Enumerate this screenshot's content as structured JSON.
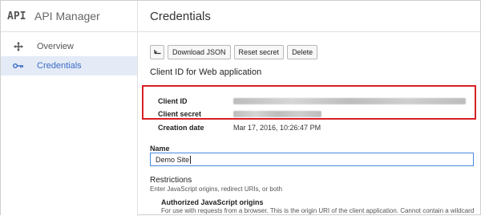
{
  "brand": {
    "logo_text": "API",
    "title": "API Manager"
  },
  "sidebar": {
    "items": [
      {
        "label": "Overview",
        "icon": "move-icon",
        "active": false
      },
      {
        "label": "Credentials",
        "icon": "key-icon",
        "active": true
      }
    ]
  },
  "header": {
    "title": "Credentials"
  },
  "toolbar": {
    "back_icon": "back-arrow-icon",
    "download_label": "Download JSON",
    "reset_label": "Reset secret",
    "delete_label": "Delete"
  },
  "client": {
    "section_title": "Client ID for Web application",
    "id_label": "Client ID",
    "secret_label": "Client secret",
    "created_label": "Creation date",
    "created_value": "Mar 17, 2016, 10:26:47 PM"
  },
  "name_field": {
    "label": "Name",
    "value": "Demo Site"
  },
  "restrictions": {
    "title": "Restrictions",
    "description": "Enter JavaScript origins, redirect URIs, or both",
    "origins_title": "Authorized JavaScript origins",
    "origins_description": "For use with requests from a browser. This is the origin URI of the client application. Cannot contain a wildcard"
  },
  "colors": {
    "highlight_border": "#d62026",
    "active_nav_bg": "#e4ebf7",
    "active_nav_text": "#3b6cc4",
    "input_border": "#4a8ae0"
  }
}
